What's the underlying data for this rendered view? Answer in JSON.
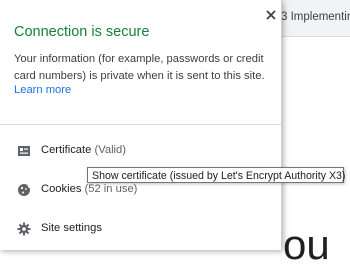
{
  "background": {
    "tab_title": "3 Implementin",
    "heading_fragment": "ou"
  },
  "popup": {
    "close_icon": "close-icon",
    "title": "Connection is secure",
    "description": "Your information (for example, passwords or credit card numbers) is private when it is sent to this site.",
    "learn_more": "Learn more",
    "title_color": "#188038",
    "link_color": "#1a73e8",
    "items": [
      {
        "icon": "certificate-icon",
        "label": "Certificate",
        "sub": "(Valid)"
      },
      {
        "icon": "cookie-icon",
        "label": "Cookies",
        "sub": "(52 in use)"
      },
      {
        "icon": "gear-icon",
        "label": "Site settings",
        "sub": ""
      }
    ]
  },
  "tooltip": {
    "text": "Show certificate (issued by Let's Encrypt Authority X3)"
  }
}
